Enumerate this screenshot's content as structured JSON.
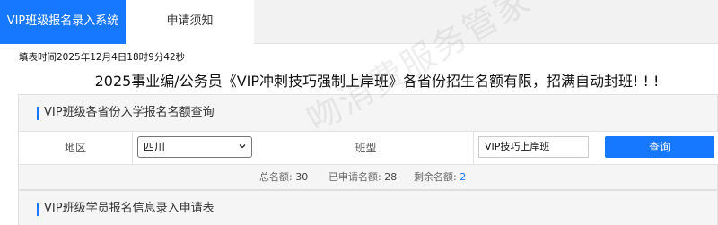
{
  "tabs": [
    {
      "label": "VIP班级报名录入系统",
      "active": true
    },
    {
      "label": "申请须知",
      "active": false
    }
  ],
  "fill_time": "填表时间2025年12月4日18时9分42秒",
  "headline": "2025事业编/公务员《VIP冲刺技巧强制上岸班》各省份招生名额有限，招满自动封班! ! !",
  "query_card": {
    "title": "VIP班级各省份入学报名名额查询",
    "region_label": "地区",
    "region_value": "四川",
    "class_label": "班型",
    "class_value": "VIP技巧上岸班",
    "query_button": "查询",
    "stats": {
      "total_label": "总名额:",
      "total_value": "30",
      "applied_label": "已申请名额:",
      "applied_value": "28",
      "remaining_label": "剩余名额:",
      "remaining_value": "2"
    }
  },
  "form_card": {
    "title": "VIP班级学员报名信息录入申请表"
  },
  "watermark": "吻消费服务管家",
  "colors": {
    "accent": "#1677ff",
    "tab_bar": "#f2f2f2",
    "card_bg": "#f5f5f5"
  }
}
